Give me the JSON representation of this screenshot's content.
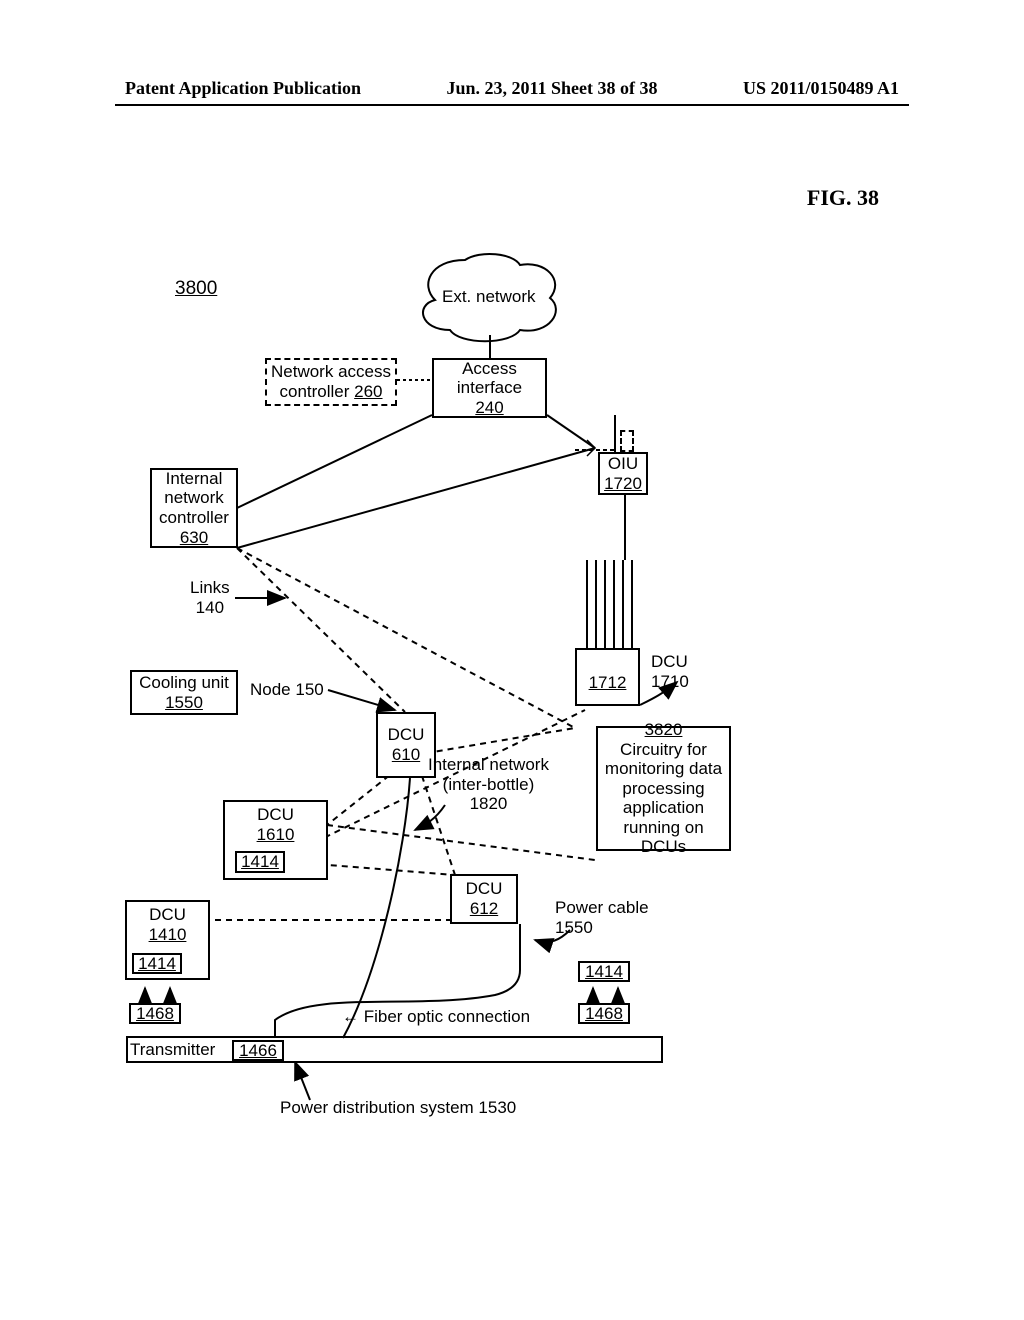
{
  "header": {
    "left": "Patent Application Publication",
    "mid": "Jun. 23, 2011  Sheet 38 of 38",
    "right": "US 2011/0150489 A1"
  },
  "fig": "FIG. 38",
  "diagram": {
    "sys_num": "3800",
    "cloud": "Ext. network",
    "nac_box": {
      "l1": "Network access",
      "l2": "controller",
      "n": "260"
    },
    "access_box": {
      "l1": "Access",
      "l2": "interface",
      "n": "240"
    },
    "inc_box": {
      "l1": "Internal",
      "l2": "network",
      "l3": "controller",
      "n": "630"
    },
    "links": {
      "l1": "Links",
      "l2": "140"
    },
    "node": "Node 150",
    "cooling": {
      "l1": "Cooling unit",
      "n": "1550"
    },
    "dcu610": {
      "l1": "DCU",
      "n": "610"
    },
    "dcu612": {
      "l1": "DCU",
      "n": "612"
    },
    "dcu1610": {
      "l1": "DCU",
      "n": "1610"
    },
    "dcu1410": {
      "l1": "DCU",
      "n": "1410"
    },
    "dcu1710": {
      "l1": "DCU",
      "l2": "1710"
    },
    "dcu1712": "1712",
    "oiu": {
      "l1": "OIU",
      "n": "1720"
    },
    "r1414a": "1414",
    "r1414b": "1414",
    "r1414c": "1414",
    "r1468a": "1468",
    "r1468b": "1468",
    "r1466": "1466",
    "xmit": "Transmitter",
    "fiber": "←  Fiber optic connection",
    "pwrcable": {
      "l1": "Power cable",
      "n": "1550"
    },
    "intnet": {
      "l1": "Internal network",
      "l2": "(inter-bottle)",
      "n": "1820"
    },
    "circ": {
      "n": "3820",
      "l1": "Circuitry for",
      "l2": "monitoring data",
      "l3": "processing",
      "l4": "application",
      "l5": "running on DCUs"
    },
    "pdist": "Power distribution system 1530"
  }
}
